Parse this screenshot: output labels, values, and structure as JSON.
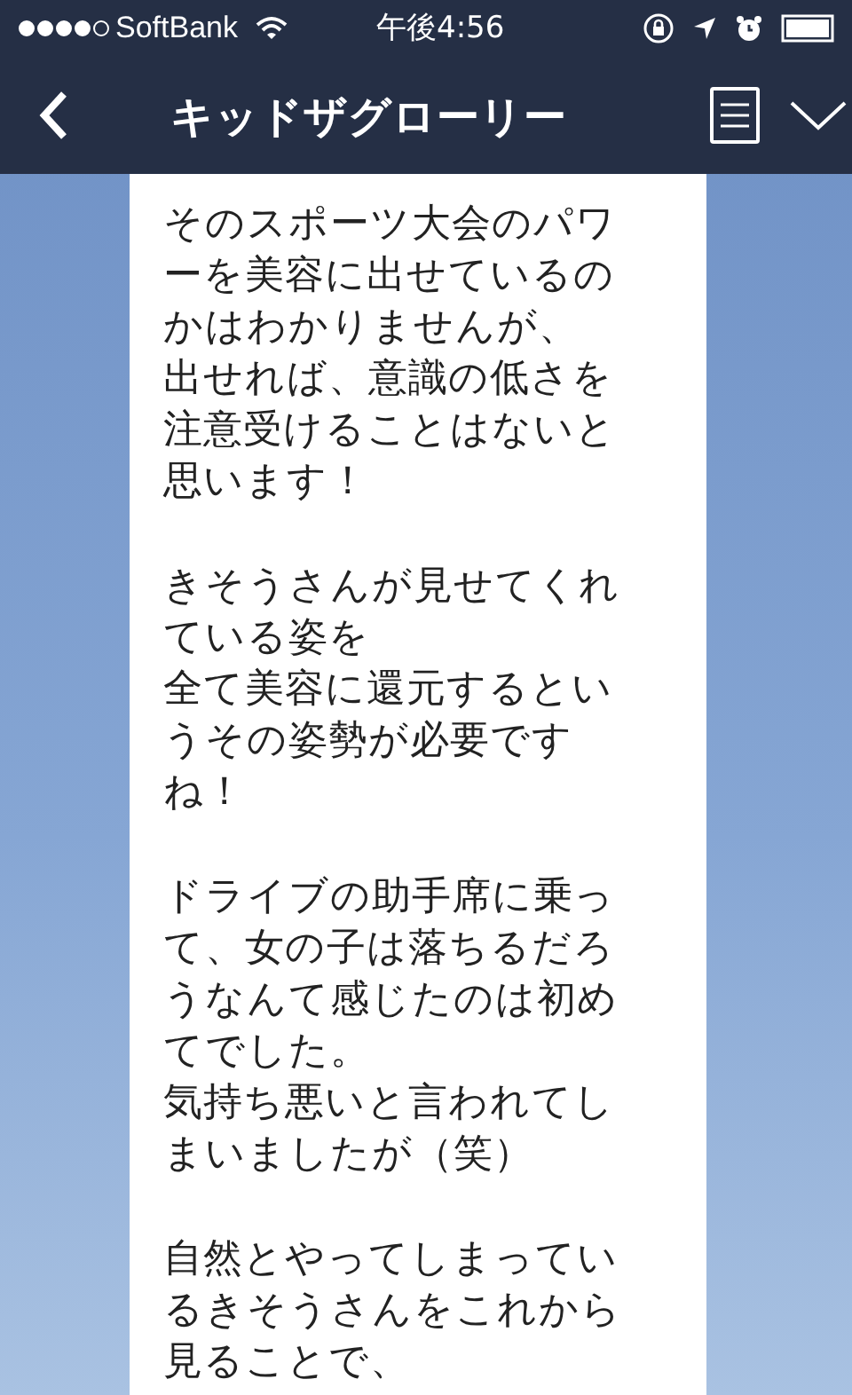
{
  "status_bar": {
    "carrier": "SoftBank",
    "time": "午後4:56"
  },
  "header": {
    "title": "キッドザグローリー"
  },
  "message": {
    "paragraphs": [
      [
        "そのスポーツ大会のパワ",
        "ーを美容に出せているの",
        "かはわかりませんが、",
        "出せれば、意識の低さを",
        "注意受けることはないと",
        "思います！"
      ],
      [
        "きそうさんが見せてくれ",
        "ている姿を",
        "全て美容に還元するとい",
        "うその姿勢が必要です",
        "ね！"
      ],
      [
        "ドライブの助手席に乗っ",
        "て、女の子は落ちるだろ",
        "うなんて感じたのは初め",
        "てでした。",
        "気持ち悪いと言われてし",
        "まいましたが（笑）"
      ],
      [
        "自然とやってしまってい",
        "るきそうさんをこれから",
        "見ることで、"
      ]
    ]
  }
}
